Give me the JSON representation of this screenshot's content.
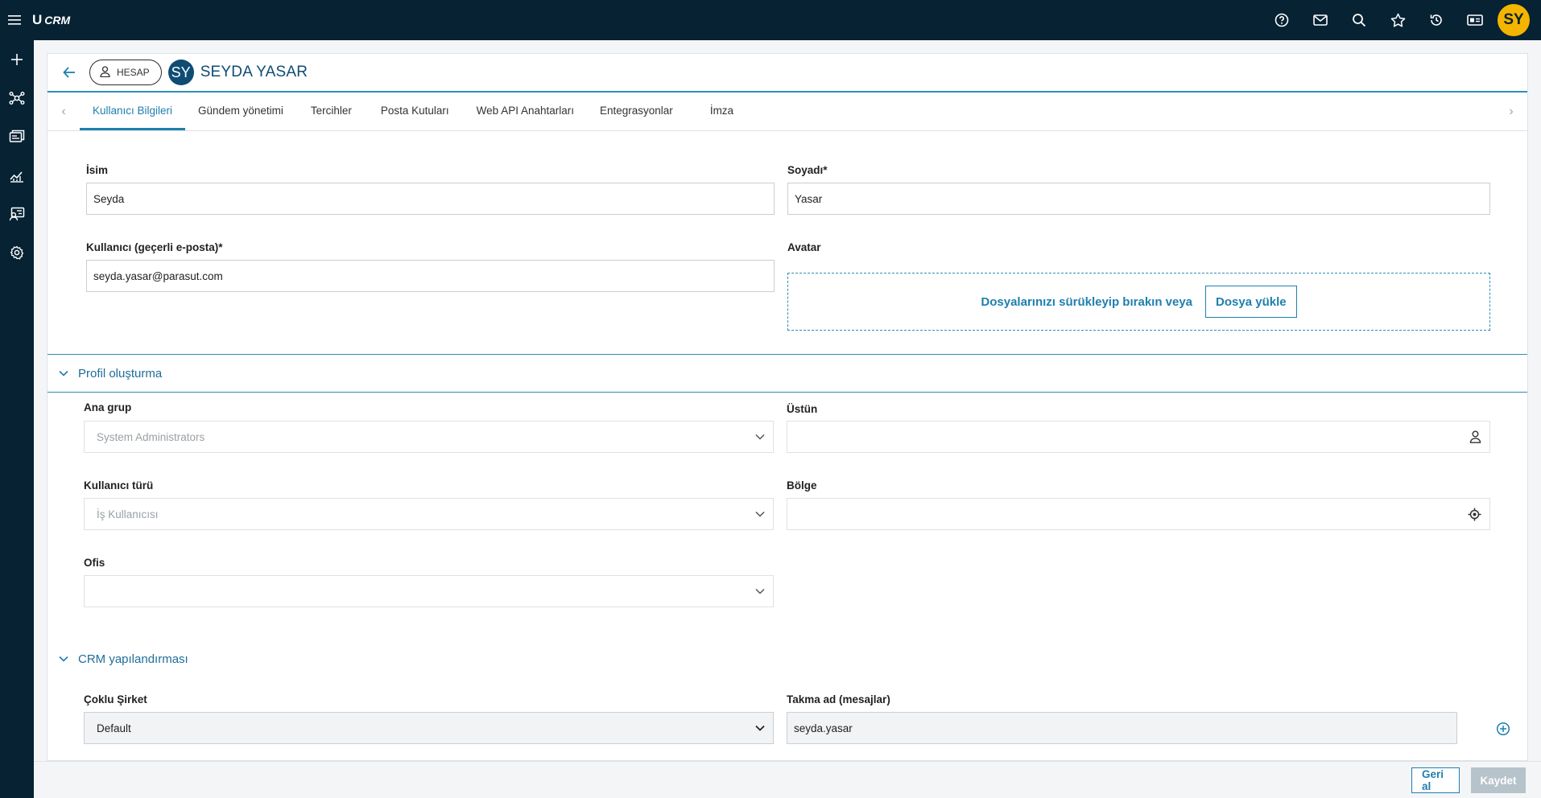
{
  "app": {
    "brand_mark": "U",
    "brand_name": "CRM",
    "user_initials": "SY"
  },
  "topbar": {
    "icons": [
      "menu-icon",
      "help-icon",
      "mail-icon",
      "search-icon",
      "star-icon",
      "history-icon",
      "id-card-icon"
    ]
  },
  "sidebar": {
    "items": [
      "add-icon",
      "network-icon",
      "inbox-icon",
      "analytics-icon",
      "user-settings-icon",
      "gear-icon"
    ]
  },
  "header": {
    "account_label": "HESAP",
    "avatar_initials": "SY",
    "user_name": "SEYDA YASAR"
  },
  "tabs": [
    {
      "label": "Kullanıcı Bilgileri",
      "active": true
    },
    {
      "label": "Gündem yönetimi",
      "active": false
    },
    {
      "label": "Tercihler",
      "active": false
    },
    {
      "label": "Posta Kutuları",
      "active": false
    },
    {
      "label": "Web API Anahtarları",
      "active": false
    },
    {
      "label": "Entegrasyonlar",
      "active": false
    },
    {
      "label": "İmza",
      "active": false
    }
  ],
  "form": {
    "first_name": {
      "label": "İsim",
      "value": "Seyda"
    },
    "last_name": {
      "label": "Soyadı*",
      "value": "Yasar"
    },
    "username": {
      "label": "Kullanıcı (geçerli e-posta)*",
      "value": "seyda.yasar@parasut.com"
    },
    "avatar": {
      "label": "Avatar",
      "drop_text": "Dosyalarınızı sürükleyip bırakın veya",
      "upload_label": "Dosya yükle"
    }
  },
  "profile_section": {
    "title": "Profil oluşturma",
    "main_group": {
      "label": "Ana grup",
      "value": "System Administrators"
    },
    "superior": {
      "label": "Üstün",
      "value": ""
    },
    "user_type": {
      "label": "Kullanıcı türü",
      "value": "İş Kullanıcısı"
    },
    "region": {
      "label": "Bölge",
      "value": ""
    },
    "office": {
      "label": "Ofis",
      "value": ""
    }
  },
  "crm_section": {
    "title": "CRM yapılandırması",
    "multi_company": {
      "label": "Çoklu Şirket",
      "value": "Default"
    },
    "nickname": {
      "label": "Takma ad (mesajlar)",
      "value": "seyda.yasar"
    }
  },
  "footer": {
    "undo_label": "Geri al",
    "save_label": "Kaydet"
  },
  "colors": {
    "topbar_bg": "#062233",
    "accent": "#1e7fae",
    "avatar_yellow": "#f4b400"
  }
}
